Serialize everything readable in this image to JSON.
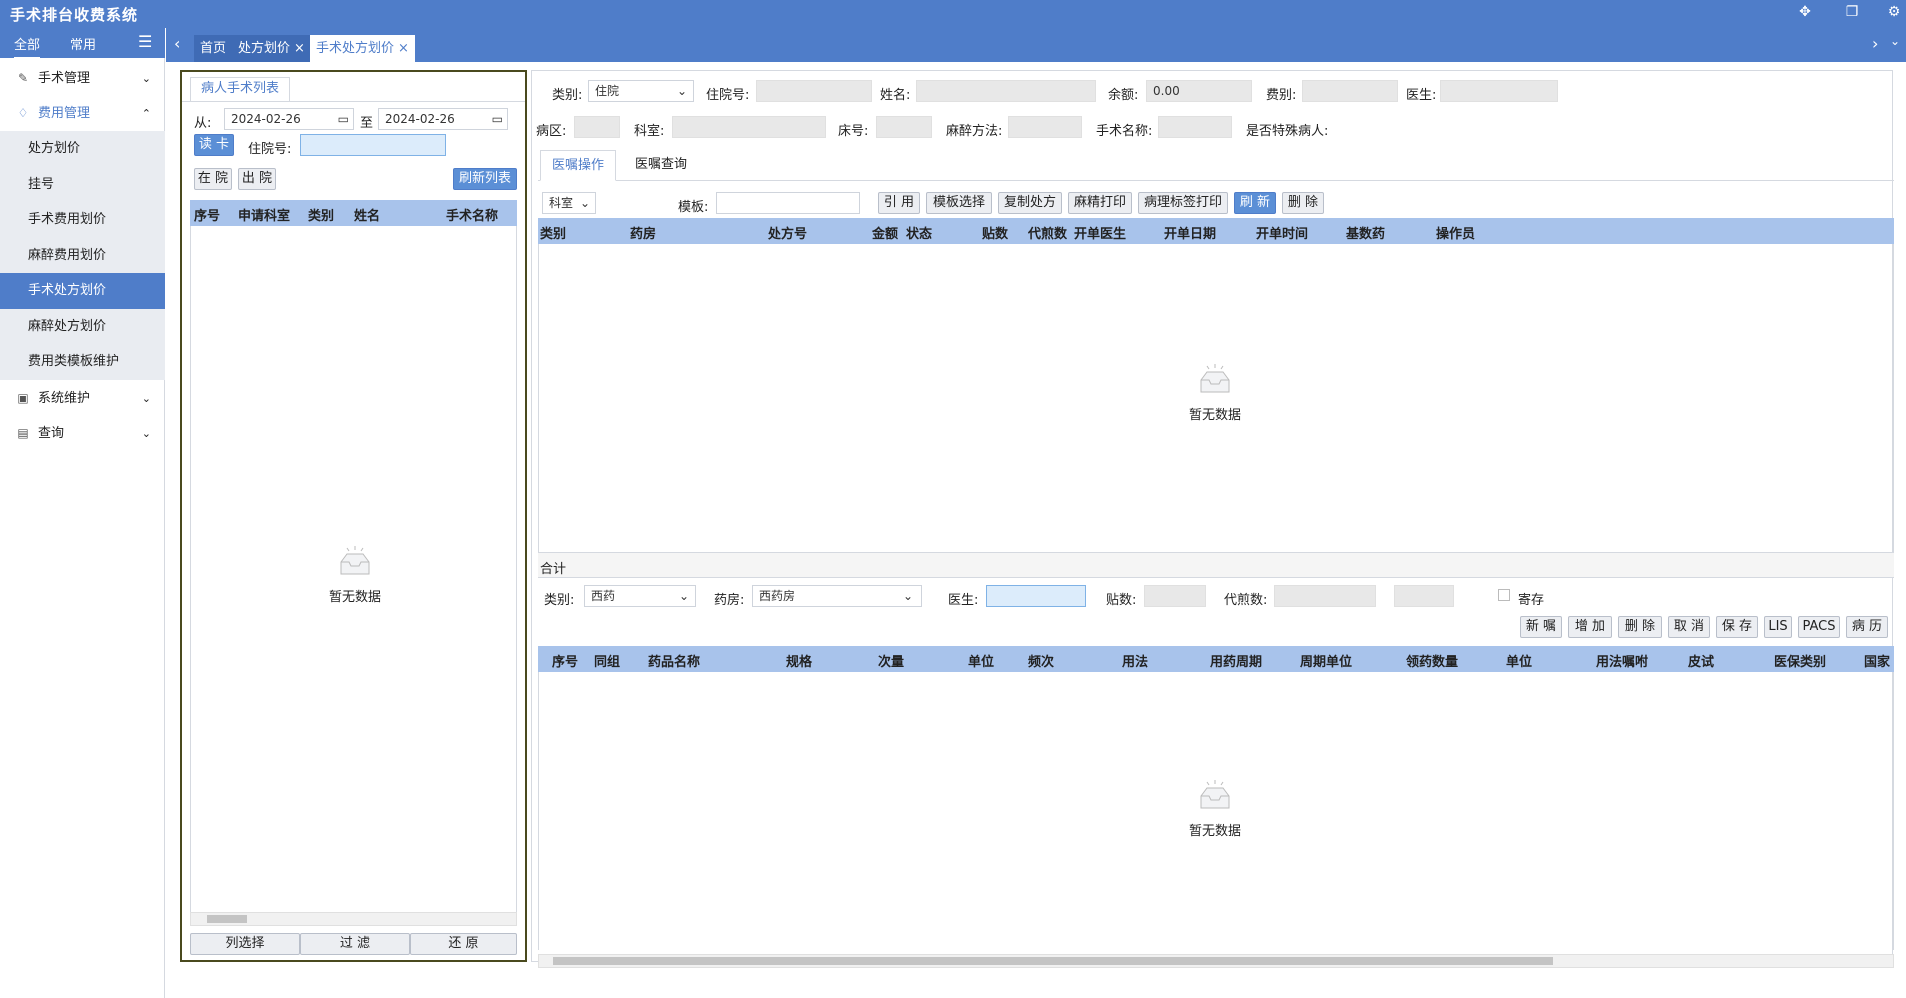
{
  "app": {
    "title": "手术排台收费系统"
  },
  "sidebar": {
    "tabs": [
      "全部",
      "常用"
    ],
    "menu": [
      {
        "label": "手术管理",
        "icon": "pen-icon"
      },
      {
        "label": "费用管理",
        "icon": "money-icon"
      },
      {
        "label": "系统维护",
        "icon": "settings-icon"
      },
      {
        "label": "查询",
        "icon": "query-icon"
      }
    ],
    "submenu": [
      "处方划价",
      "挂号",
      "手术费用划价",
      "麻醉费用划价",
      "手术处方划价",
      "麻醉处方划价",
      "费用类模板维护"
    ]
  },
  "tabs": [
    {
      "label": "首页"
    },
    {
      "label": "处方划价"
    },
    {
      "label": "手术处方划价"
    }
  ],
  "left": {
    "panel_tab": "病人手术列表",
    "from_label": "从:",
    "from_date": "2024-02-26",
    "to_label": "至",
    "to_date": "2024-02-26",
    "read_card": "读 卡",
    "inpatient_label": "住院号:",
    "in_hosp": "在 院",
    "out_hosp": "出 院",
    "refresh_list": "刷新列表",
    "columns": [
      "序号",
      "申请科室",
      "类别",
      "姓名",
      "手术名称"
    ],
    "empty": "暂无数据",
    "footer": [
      "列选择",
      "过 滤",
      "还 原"
    ]
  },
  "header": {
    "category_label": "类别:",
    "category_value": "住院",
    "inpatient_label": "住院号:",
    "name_label": "姓名:",
    "balance_label": "余额:",
    "balance_value": "0.00",
    "fee_label": "费别:",
    "doctor_label": "医生:",
    "ward_label": "病区:",
    "dept_label": "科室:",
    "bed_label": "床号:",
    "anesthesia_label": "麻醉方法:",
    "surgery_label": "手术名称:",
    "special_label": "是否特殊病人:"
  },
  "subtabs": [
    "医嘱操作",
    "医嘱查询"
  ],
  "toolbar": {
    "dept_select": "科室",
    "template_label": "模板:",
    "buttons": [
      "引 用",
      "模板选择",
      "复制处方",
      "麻精打印",
      "病理标签打印",
      "刷 新",
      "删 除"
    ]
  },
  "upper_grid": {
    "columns": [
      "类别",
      "药房",
      "处方号",
      "金额",
      "状态",
      "贴数",
      "代煎数",
      "开单医生",
      "开单日期",
      "开单时间",
      "基数药",
      "操作员"
    ],
    "empty": "暂无数据",
    "total_label": "合计"
  },
  "detail": {
    "category_label": "类别:",
    "category_value": "西药",
    "pharmacy_label": "药房:",
    "pharmacy_value": "西药房",
    "doctor_label": "医生:",
    "doses_label": "贴数:",
    "decoct_label": "代煎数:",
    "deposit_label": "寄存"
  },
  "detail_buttons": [
    "新 嘱",
    "增 加",
    "删 除",
    "取 消",
    "保 存",
    "LIS",
    "PACS",
    "病 历"
  ],
  "lower_grid": {
    "columns": [
      "序号",
      "同组",
      "药品名称",
      "规格",
      "次量",
      "单位",
      "频次",
      "用法",
      "用药周期",
      "周期单位",
      "领药数量",
      "单位",
      "用法嘱咐",
      "皮试",
      "医保类别",
      "国家"
    ],
    "empty": "暂无数据"
  }
}
